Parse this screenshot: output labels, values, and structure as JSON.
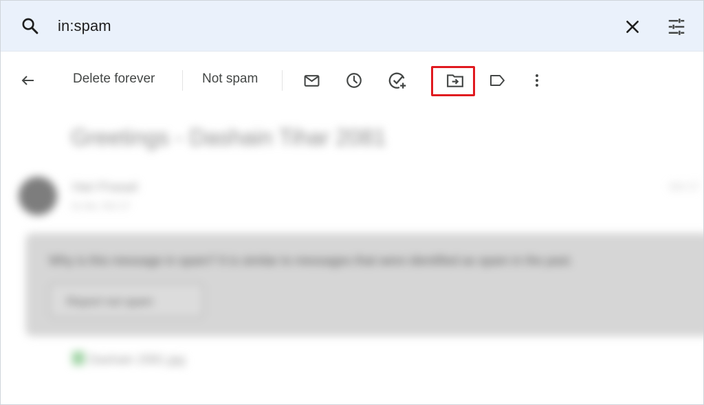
{
  "search": {
    "query": "in:spam"
  },
  "toolbar": {
    "back_icon": "arrow-back-icon",
    "delete_forever_label": "Delete forever",
    "not_spam_label": "Not spam",
    "icons": [
      "mark-unread-icon",
      "snooze-icon",
      "add-task-icon",
      "move-to-icon",
      "label-icon",
      "more-vert-icon"
    ],
    "highlight_color": "#e0191f"
  },
  "message": {
    "subject": "Greetings - Dashain Tihar 2081",
    "sender_name": "Hari Prasad",
    "sender_sub": "to me, Oct 17",
    "date": "Oct 17",
    "warning": "Why is this message in spam? It is similar to messages that were identified as spam in the past.",
    "report_button": "Report not spam",
    "attachment": "Dashain 2081.jpg"
  }
}
